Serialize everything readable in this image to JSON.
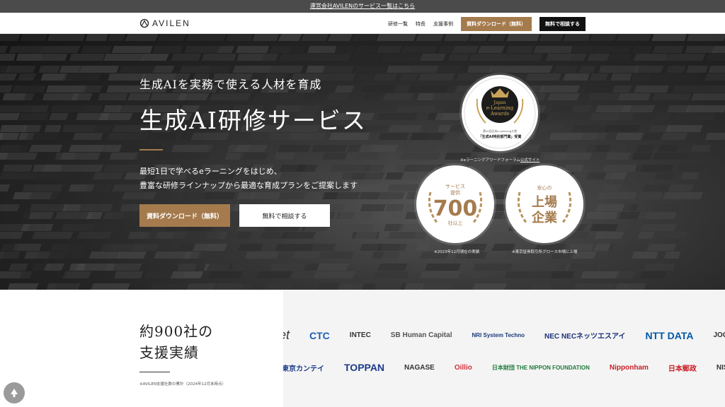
{
  "notice": {
    "text": "運営会社AVILENのサービス一覧はこちら"
  },
  "header": {
    "logo_text": "AVILEN",
    "nav": [
      "研修一覧",
      "特長",
      "支援事例"
    ],
    "doc_button": "資料ダウンロード（無料）",
    "consult_button": "無料で相談する"
  },
  "hero": {
    "subtitle": "生成AIを実務で使える人材を育成",
    "title": "生成AI研修サービス",
    "desc_line1": "最短1日で学べるeラーニングをはじめ、",
    "desc_line2": "豊富な研修ラインナップから最適な育成プランをご提案します",
    "doc_button": "資料ダウンロード（無料）",
    "consult_button": "無料で相談する",
    "award": {
      "line1": "Japan",
      "line2": "e-Learning",
      "line3": "Awards",
      "caption_small": "第20回日本e-Learning大賞",
      "caption": "「生成AI特別部門賞」受賞",
      "note_prefix": "※eラーニングアワードフォーラム",
      "note_link": "公式サイト"
    },
    "badge_700": {
      "top": "サービス",
      "top2": "提供",
      "number": "700",
      "bottom": "社以上",
      "note": "※2023年12月現在の実績"
    },
    "badge_listed": {
      "top": "安心の",
      "line1": "上場",
      "line2": "企業",
      "note": "※東京証券取引所グロース市場に上場"
    }
  },
  "clients": {
    "title_line1": "約900社の",
    "title_line2": "支援実績",
    "note": "※AVILEN支援社数の累計（2024年12月末時点）",
    "row1": [
      {
        "name": "et",
        "color": "#3a3a3a"
      },
      {
        "name": "CTC",
        "color": "#1a5fb4"
      },
      {
        "name": "INTEC",
        "color": "#333333"
      },
      {
        "name": "SB Human Capital",
        "color": "#555555"
      },
      {
        "name": "NRI System Techno",
        "color": "#1b3a7a"
      },
      {
        "name": "NEC NECネッツエスアイ",
        "color": "#1b2f7a"
      },
      {
        "name": "NTT DATA",
        "color": "#0058a8"
      },
      {
        "name": "JOGMEC",
        "color": "#333333"
      }
    ],
    "row2": [
      {
        "name": "東京カンテイ",
        "color": "#1b3a8a"
      },
      {
        "name": "TOPPAN",
        "color": "#1b3a8a"
      },
      {
        "name": "NAGASE",
        "color": "#333333"
      },
      {
        "name": "Oillio",
        "color": "#d4303a"
      },
      {
        "name": "日本財団 THE NIPPON FOUNDATION",
        "color": "#1f7a3a"
      },
      {
        "name": "Nipponham",
        "color": "#c82027"
      },
      {
        "name": "日本郵政",
        "color": "#c82027"
      },
      {
        "name": "NISSAN",
        "color": "#333333"
      }
    ]
  },
  "colors": {
    "accent": "#a57b4d",
    "dark": "#111111"
  }
}
